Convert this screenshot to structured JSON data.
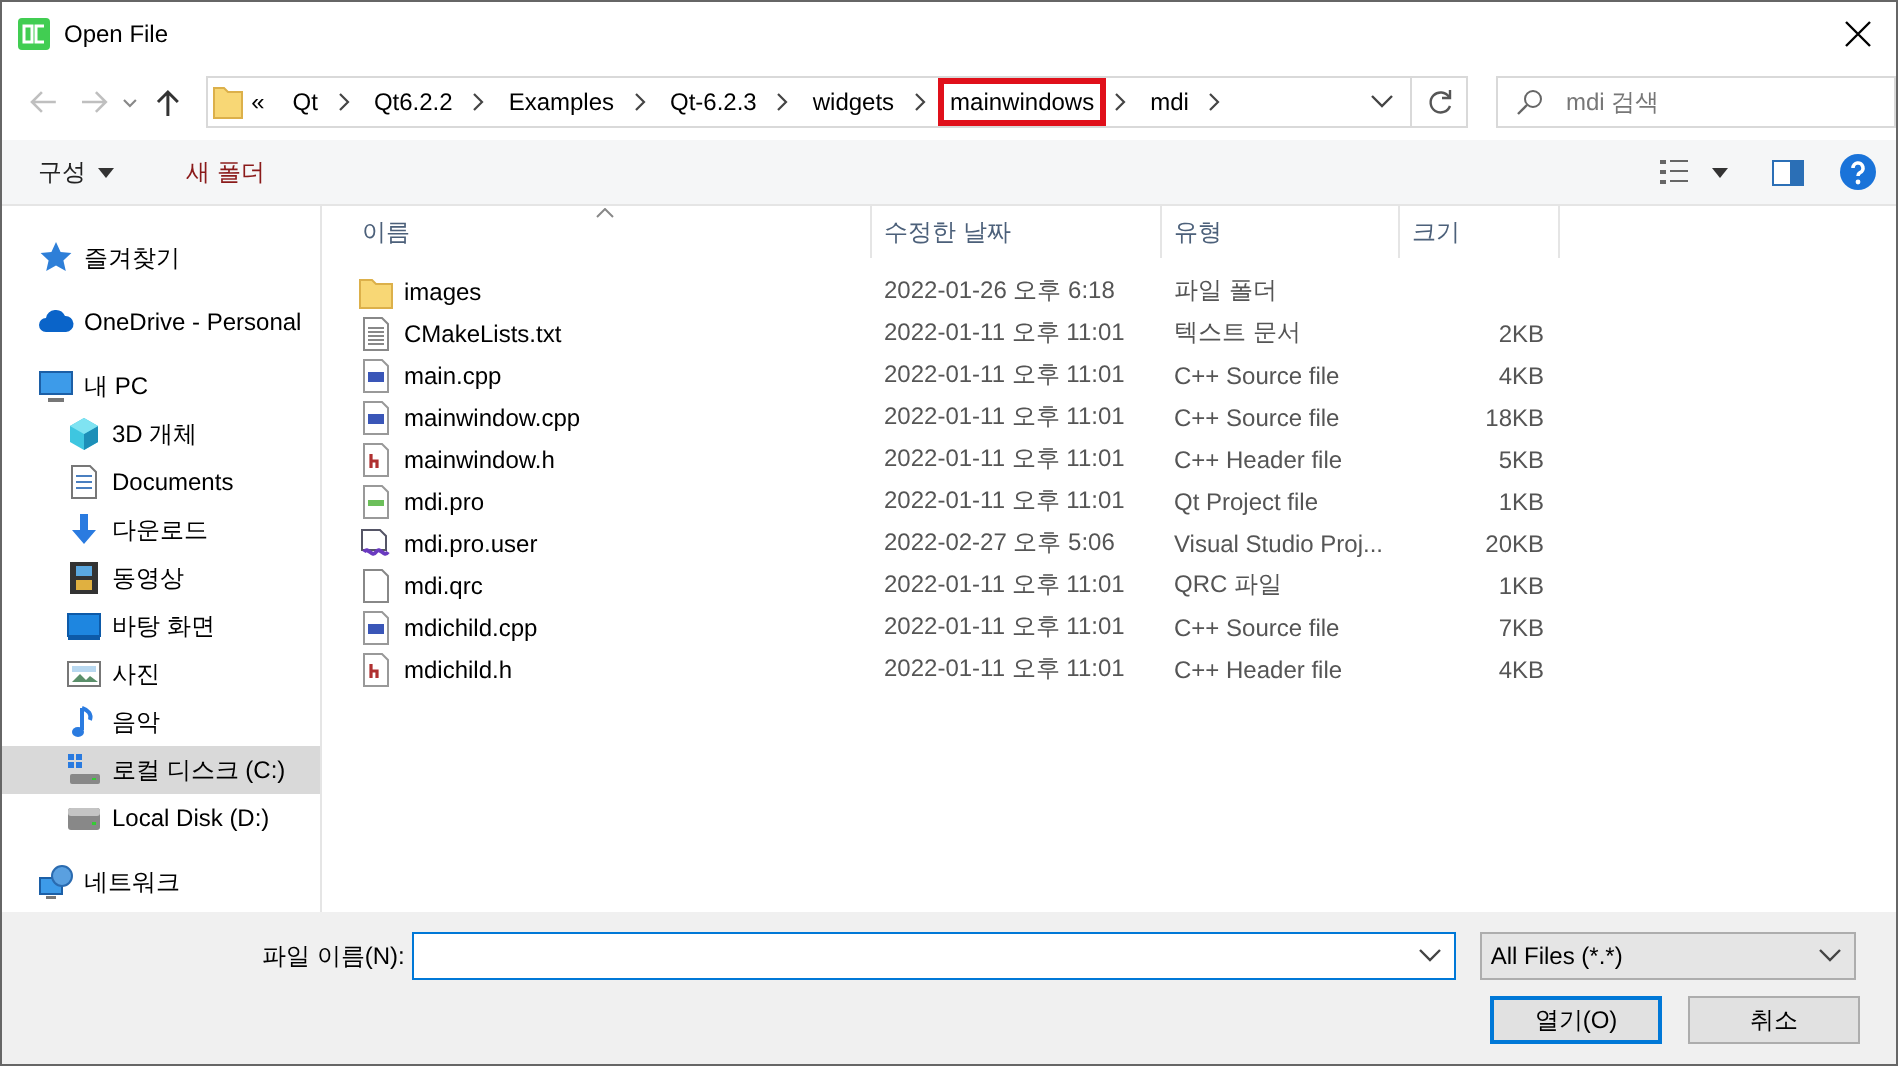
{
  "window": {
    "title": "Open File"
  },
  "nav": {
    "back_disabled": true,
    "forward_disabled": true
  },
  "address": {
    "overflow": "«",
    "crumbs": [
      {
        "label": "Qt",
        "highlighted": false
      },
      {
        "label": "Qt6.2.2",
        "highlighted": false
      },
      {
        "label": "Examples",
        "highlighted": false
      },
      {
        "label": "Qt-6.2.3",
        "highlighted": false
      },
      {
        "label": "widgets",
        "highlighted": false
      },
      {
        "label": "mainwindows",
        "highlighted": true
      },
      {
        "label": "mdi",
        "highlighted": false
      }
    ]
  },
  "search": {
    "placeholder": "mdi 검색"
  },
  "toolbar": {
    "organize": "구성",
    "new_folder": "새 폴더"
  },
  "sidebar": {
    "items": [
      {
        "label": "즐겨찾기",
        "kind": "star",
        "selected": false
      },
      {
        "label": "OneDrive - Personal",
        "kind": "cloud",
        "selected": false
      },
      {
        "label": "내 PC",
        "kind": "pc",
        "selected": false,
        "children": [
          {
            "label": "3D 개체",
            "kind": "cube",
            "selected": false
          },
          {
            "label": "Documents",
            "kind": "docs",
            "selected": false
          },
          {
            "label": "다운로드",
            "kind": "download",
            "selected": false
          },
          {
            "label": "동영상",
            "kind": "video",
            "selected": false
          },
          {
            "label": "바탕 화면",
            "kind": "desktop",
            "selected": false
          },
          {
            "label": "사진",
            "kind": "photo",
            "selected": false
          },
          {
            "label": "음악",
            "kind": "music",
            "selected": false
          },
          {
            "label": "로컬 디스크 (C:)",
            "kind": "sysdrive",
            "selected": true
          },
          {
            "label": "Local Disk (D:)",
            "kind": "drive",
            "selected": false
          }
        ]
      },
      {
        "label": "네트워크",
        "kind": "network",
        "selected": false
      }
    ]
  },
  "table": {
    "columns": [
      {
        "label": "이름",
        "sorted": true
      },
      {
        "label": "수정한 날짜",
        "sorted": false
      },
      {
        "label": "유형",
        "sorted": false
      },
      {
        "label": "크기",
        "sorted": false
      }
    ],
    "rows": [
      {
        "name": "images",
        "kind": "folder",
        "date": "2022-01-26 오후 6:18",
        "type": "파일 폴더"
      },
      {
        "name": "CMakeLists.txt",
        "kind": "text",
        "date": "2022-01-11 오후 11:01",
        "type": "텍스트 문서",
        "size": "2KB"
      },
      {
        "name": "main.cpp",
        "kind": "cpp",
        "date": "2022-01-11 오후 11:01",
        "type": "C++ Source file",
        "size": "4KB"
      },
      {
        "name": "mainwindow.cpp",
        "kind": "cpp",
        "date": "2022-01-11 오후 11:01",
        "type": "C++ Source file",
        "size": "18KB"
      },
      {
        "name": "mainwindow.h",
        "kind": "header",
        "date": "2022-01-11 오후 11:01",
        "type": "C++ Header file",
        "size": "5KB"
      },
      {
        "name": "mdi.pro",
        "kind": "pro",
        "date": "2022-01-11 오후 11:01",
        "type": "Qt Project file",
        "size": "1KB"
      },
      {
        "name": "mdi.pro.user",
        "kind": "user",
        "date": "2022-02-27 오후 5:06",
        "type": "Visual Studio Proj...",
        "size": "20KB"
      },
      {
        "name": "mdi.qrc",
        "kind": "blank",
        "date": "2022-01-11 오후 11:01",
        "type": "QRC 파일",
        "size": "1KB"
      },
      {
        "name": "mdichild.cpp",
        "kind": "cpp",
        "date": "2022-01-11 오후 11:01",
        "type": "C++ Source file",
        "size": "7KB"
      },
      {
        "name": "mdichild.h",
        "kind": "header",
        "date": "2022-01-11 오후 11:01",
        "type": "C++ Header file",
        "size": "4KB"
      }
    ]
  },
  "footer": {
    "filename_label": "파일 이름(N):",
    "filter": "All Files (*.*)",
    "open": "열기(O)",
    "cancel": "취소"
  }
}
